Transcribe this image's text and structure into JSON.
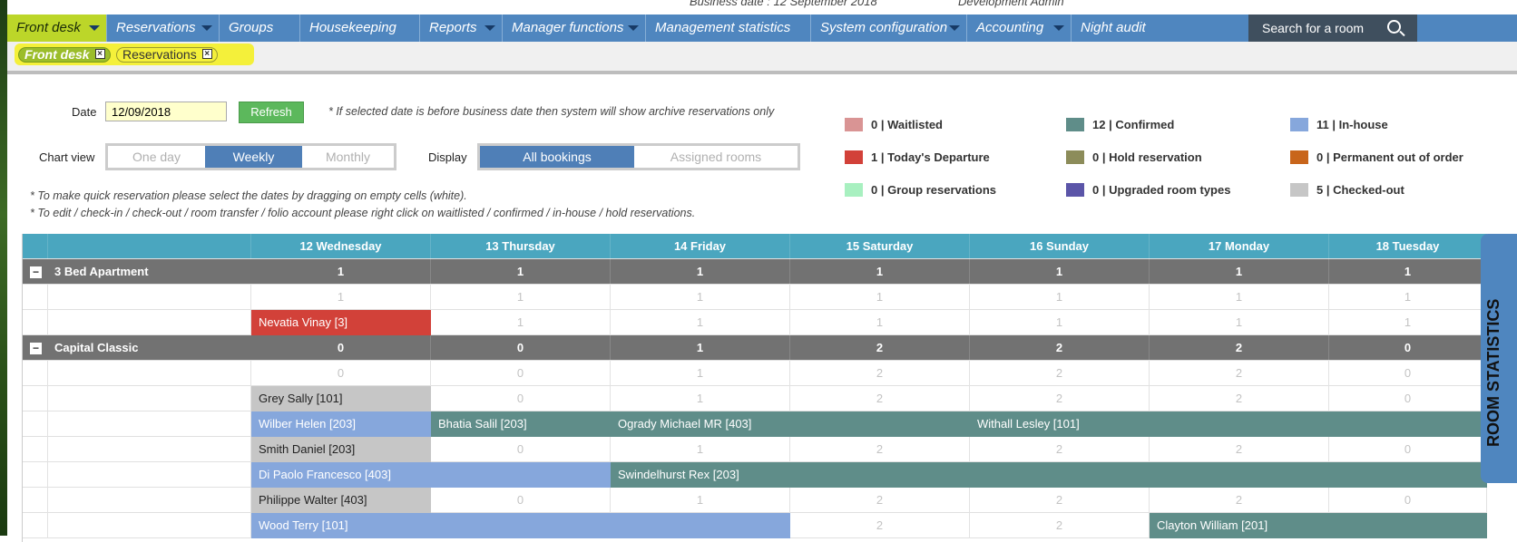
{
  "topbar": {
    "user": "Development Admin",
    "business_date": "Business date : 12 September 2018"
  },
  "nav": {
    "items": [
      {
        "label": "Front desk",
        "dropdown": true,
        "active": true
      },
      {
        "label": "Reservations",
        "dropdown": true
      },
      {
        "label": "Groups",
        "dropdown": false
      },
      {
        "label": "Housekeeping",
        "dropdown": false
      },
      {
        "label": "Reports",
        "dropdown": true
      },
      {
        "label": "Manager functions",
        "dropdown": true
      },
      {
        "label": "Management statistics",
        "dropdown": false
      },
      {
        "label": "System configuration",
        "dropdown": true
      },
      {
        "label": "Accounting",
        "dropdown": true
      },
      {
        "label": "Night audit",
        "dropdown": false
      }
    ],
    "search_label": "Search for a room"
  },
  "tabs": [
    {
      "label": "Front desk",
      "active": true
    },
    {
      "label": "Reservations",
      "active": false
    }
  ],
  "controls": {
    "date_label": "Date",
    "date_value": "12/09/2018",
    "refresh_label": "Refresh",
    "date_note": "* If selected date is before business date then system will show archive reservations only",
    "chart_view_label": "Chart view",
    "chart_view_options": [
      "One day",
      "Weekly",
      "Monthly"
    ],
    "chart_view_selected": "Weekly",
    "display_label": "Display",
    "display_options": [
      "All bookings",
      "Assigned rooms"
    ],
    "display_selected": "All bookings",
    "note1": "* To make quick reservation please select the dates by dragging on empty cells (white).",
    "note2": "* To edit / check-in / check-out / room transfer / folio account please right click on waitlisted / confirmed / in-house / hold reservations."
  },
  "legend": [
    {
      "label": "0 | Waitlisted",
      "color": "#d99494"
    },
    {
      "label": "12 | Confirmed",
      "color": "#5f8d89"
    },
    {
      "label": "11 | In-house",
      "color": "#86a7dc"
    },
    {
      "label": "1 | Today's Departure",
      "color": "#d24139"
    },
    {
      "label": "0 | Hold reservation",
      "color": "#8c8c5a"
    },
    {
      "label": "0 | Permanent out of order",
      "color": "#c8651b"
    },
    {
      "label": "0 | Group reservations",
      "color": "#a8f0c0"
    },
    {
      "label": "0 | Upgraded room types",
      "color": "#5b55a8"
    },
    {
      "label": "5 | Checked-out",
      "color": "#c6c6c6"
    }
  ],
  "grid": {
    "days": [
      "12 Wednesday",
      "13 Thursday",
      "14 Friday",
      "15 Saturday",
      "16 Sunday",
      "17 Monday",
      "18 Tuesday"
    ],
    "categories": [
      {
        "name": "3 Bed Apartment",
        "availability": [
          "1",
          "1",
          "1",
          "1",
          "1",
          "1",
          "1"
        ]
      },
      {
        "name": "Capital Classic",
        "availability": [
          "0",
          "0",
          "1",
          "2",
          "2",
          "2",
          "0"
        ]
      }
    ],
    "room_rows": [
      [
        "1",
        "1",
        "1",
        "1",
        "1",
        "1",
        "1"
      ],
      [
        "",
        "1",
        "1",
        "1",
        "1",
        "1",
        "1"
      ],
      [
        "0",
        "0",
        "1",
        "2",
        "2",
        "2",
        "0"
      ],
      [
        "",
        "0",
        "1",
        "2",
        "2",
        "2",
        "0"
      ],
      [
        "",
        "",
        "",
        "",
        "",
        "",
        ""
      ],
      [
        "",
        "0",
        "1",
        "2",
        "2",
        "2",
        "0"
      ],
      [
        "",
        "",
        "",
        "",
        "",
        "",
        ""
      ],
      [
        "",
        "0",
        "1",
        "2",
        "2",
        "2",
        "0"
      ],
      [
        "",
        "",
        "",
        "2",
        "2",
        "",
        ""
      ]
    ],
    "bookings": {
      "b1": "Nevatia Vinay [3]",
      "b2": "Grey Sally [101]",
      "b3": "Wilber Helen [203]",
      "b4": "Bhatia Salil [203]",
      "b5": "Ogrady Michael MR [403]",
      "b6": "Withall Lesley [101]",
      "b7": "Smith Daniel [203]",
      "b8": "Di Paolo Francesco [403]",
      "b9": "Swindelhurst Rex [203]",
      "b10": "Philippe Walter [403]",
      "b11": "Wood Terry [101]",
      "b12": "Clayton William [201]"
    }
  },
  "room_statistics_label": "ROOM STATISTICS"
}
